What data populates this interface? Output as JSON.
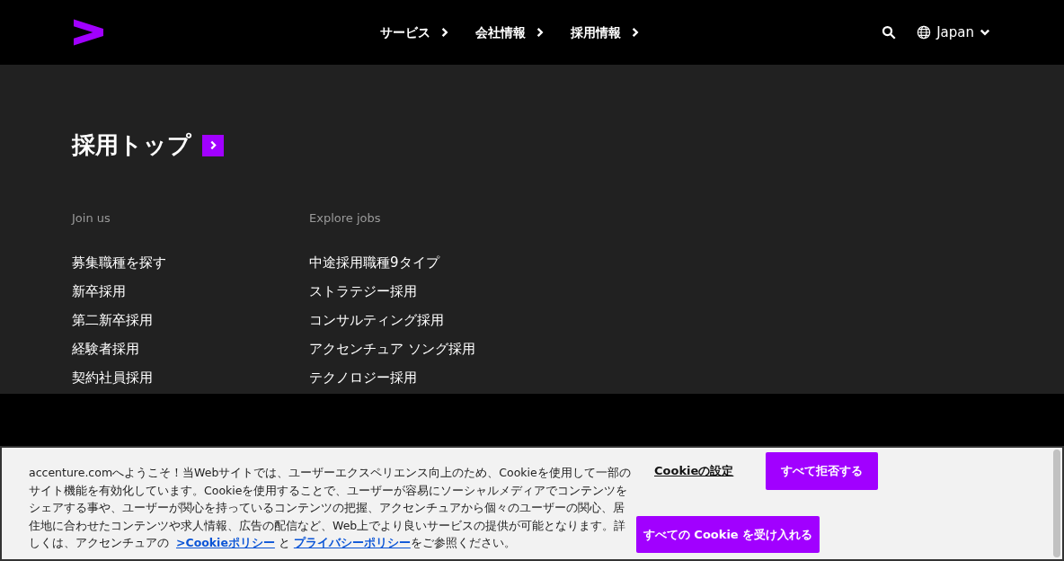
{
  "header": {
    "nav": [
      {
        "label": "サービス"
      },
      {
        "label": "会社情報"
      },
      {
        "label": "採用情報"
      }
    ],
    "region": "Japan"
  },
  "menu": {
    "title": "採用トップ",
    "columns": [
      {
        "heading": "Join us",
        "links": [
          "募集職種を探す",
          "新卒採用",
          "第二新卒採用",
          "経験者採用",
          "契約社員採用"
        ]
      },
      {
        "heading": "Explore jobs",
        "links": [
          "中途採用職種9タイプ",
          "ストラテジー採用",
          "コンサルティング採用",
          "アクセンチュア ソング採用",
          "テクノロジー採用"
        ]
      }
    ]
  },
  "cookie_banner": {
    "text_before": "accenture.comへようこそ！当Webサイトでは、ユーザーエクスペリエンス向上のため、Cookieを使用して一部のサイト機能を有効化しています。Cookieを使用することで、ユーザーが容易にソーシャルメディアでコンテンツをシェアする事や、ユーザーが関心を持っているコンテンツの把握、アクセンチュアから個々のユーザーの関心、居住地に合わせたコンテンツや求人情報、広告の配信など、Web上でより良いサービスの提供が可能となります。詳しくは、アクセンチュアの ",
    "link_1": ">Cookieポリシー",
    "between": " と ",
    "link_2": "プライバシーポリシー",
    "text_after": "をご参照ください。",
    "settings_link": "Cookieの設定",
    "reject_button": "すべて拒否する",
    "accept_button": "すべての Cookie を受け入れる"
  }
}
